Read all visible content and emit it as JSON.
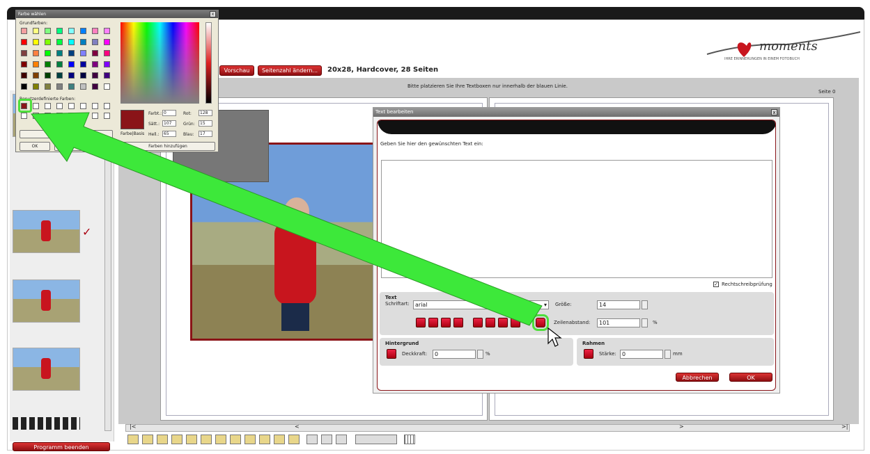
{
  "toolbar": {
    "preview_label": "Vorschau",
    "change_pages_label": "Seitenzahl ändern...",
    "book_info": "20x28, Hardcover, 28 Seiten"
  },
  "brand": {
    "logo_text": "moments",
    "tagline": "IHRE ERINNERUNGEN IN EINEM FOTOBUCH",
    "accent": "#c8151e"
  },
  "canvas": {
    "instruction": "Bitte platzieren Sie Ihre Textboxen nur innerhalb der blauen Linie.",
    "page_label": "Seite 0"
  },
  "left_panel": {
    "end_program": "Programm beenden"
  },
  "text_dialog": {
    "title": "Text bearbeiten",
    "close": "x",
    "prompt": "Geben Sie hier den gewünschten Text ein:",
    "spellcheck": "Rechtschreibprüfung",
    "text_group": "Text",
    "font_label": "Schriftart:",
    "font_value": "arial",
    "size_label": "Größe:",
    "size_value": "14",
    "line_spacing_label": "Zeilenabstand:",
    "line_spacing_value": "101",
    "percent": "%",
    "bg_group": "Hintergrund",
    "opacity_label": "Deckkraft:",
    "opacity_value": "0",
    "frame_group": "Rahmen",
    "thickness_label": "Stärke:",
    "thickness_value": "0",
    "mm": "mm",
    "cancel": "Abbrechen",
    "ok": "OK"
  },
  "color_dialog": {
    "title": "Farbe wählen",
    "basic_colors": "Grundfarben:",
    "custom_colors": "Benutzerdefinierte Farben:",
    "hue_label": "Farbt.:",
    "hue_value": "0",
    "sat_label": "Sätt.:",
    "sat_value": "107",
    "lum_label": "Hell.:",
    "lum_value": "65",
    "red_label": "Rot:",
    "red_value": "128",
    "green_label": "Grün:",
    "green_value": "15",
    "blue_label": "Blau:",
    "blue_value": "17",
    "colorbase": "Farbe|Basis",
    "ok": "OK",
    "cancel": "Abbrechen",
    "add_colors": "Farben hinzufügen",
    "close": "x",
    "selected_color": "#8a1418",
    "swatches": [
      "#f4a0a0",
      "#ffff80",
      "#80ff80",
      "#00ff80",
      "#80ffff",
      "#0080ff",
      "#ff80c0",
      "#ff80ff",
      "#ff0000",
      "#ffff00",
      "#80ff00",
      "#00ff40",
      "#00ffff",
      "#0080c0",
      "#8080c0",
      "#ff00ff",
      "#804040",
      "#ff8040",
      "#00ff00",
      "#008080",
      "#004080",
      "#8080ff",
      "#800040",
      "#ff0080",
      "#800000",
      "#ff8000",
      "#008000",
      "#008040",
      "#0000ff",
      "#0000a0",
      "#800080",
      "#8000ff",
      "#400000",
      "#804000",
      "#004000",
      "#004040",
      "#000080",
      "#000040",
      "#400040",
      "#400080",
      "#000000",
      "#808000",
      "#808040",
      "#808080",
      "#408080",
      "#c0c0c0",
      "#400040",
      "#ffffff"
    ]
  },
  "pager": {
    "left": "<",
    "right": ">",
    "first": "|<",
    "last": ">|"
  },
  "checkmark": "✓"
}
